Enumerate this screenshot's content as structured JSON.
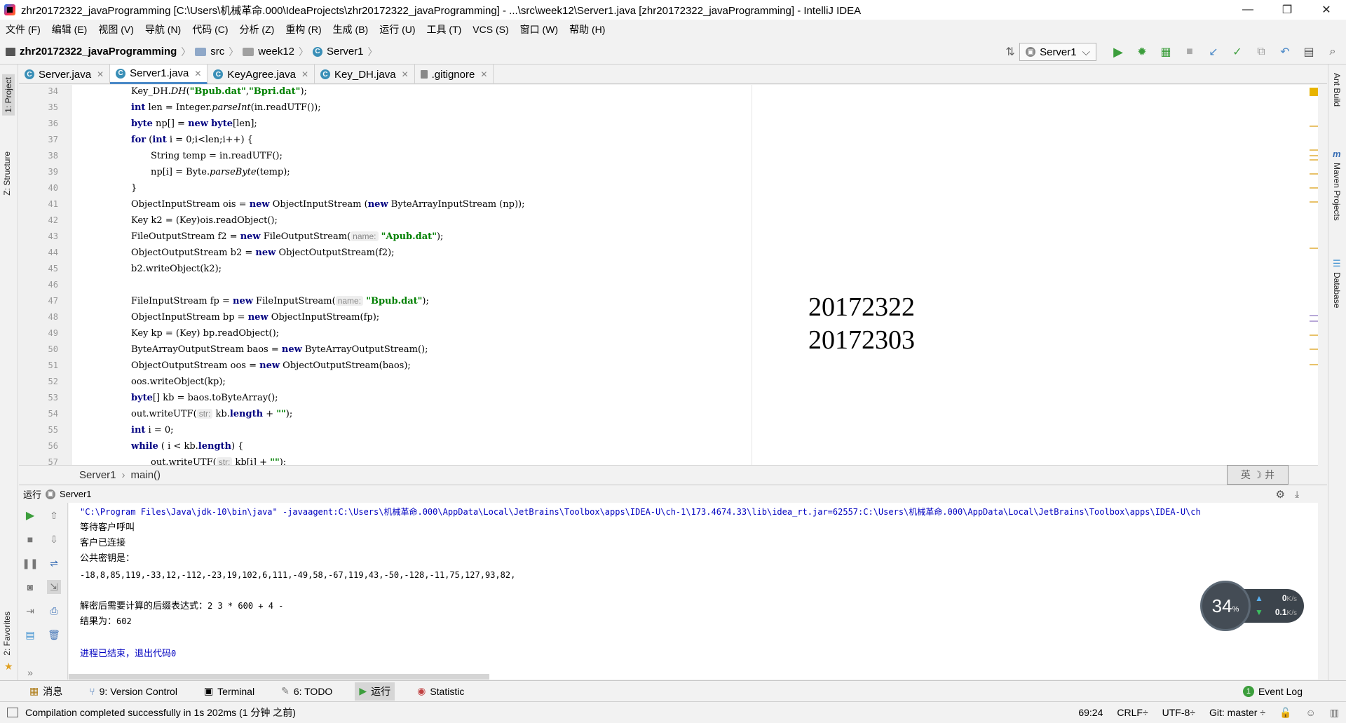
{
  "window": {
    "title": "zhr20172322_javaProgramming [C:\\Users\\机械革命.000\\IdeaProjects\\zhr20172322_javaProgramming] - ...\\src\\week12\\Server1.java [zhr20172322_javaProgramming] - IntelliJ IDEA",
    "minimize": "—",
    "restore": "❐",
    "close": "✕"
  },
  "menu": [
    "文件 (F)",
    "编辑 (E)",
    "视图 (V)",
    "导航 (N)",
    "代码 (C)",
    "分析 (Z)",
    "重构 (R)",
    "生成 (B)",
    "运行 (U)",
    "工具 (T)",
    "VCS (S)",
    "窗口 (W)",
    "帮助 (H)"
  ],
  "nav": {
    "project": "zhr20172322_javaProgramming",
    "src": "src",
    "pkg": "week12",
    "cls": "Server1",
    "run_config": "Server1"
  },
  "left_tools": {
    "project": "1: Project",
    "structure": "Z: Structure",
    "favorites": "2: Favorites"
  },
  "right_tools": {
    "ant": "Ant Build",
    "maven": "Maven Projects",
    "database": "Database"
  },
  "tabs": [
    {
      "label": "Server.java",
      "active": false
    },
    {
      "label": "Server1.java",
      "active": true
    },
    {
      "label": "KeyAgree.java",
      "active": false
    },
    {
      "label": "Key_DH.java",
      "active": false
    },
    {
      "label": ".gitignore",
      "active": false
    }
  ],
  "line_numbers": [
    "34",
    "35",
    "36",
    "37",
    "38",
    "39",
    "40",
    "41",
    "42",
    "43",
    "44",
    "45",
    "46",
    "47",
    "48",
    "49",
    "50",
    "51",
    "52",
    "53",
    "54",
    "55",
    "56",
    "57"
  ],
  "overlay": {
    "line1": "20172322",
    "line2": "20172303"
  },
  "editor_breadcrumb": {
    "cls": "Server1",
    "method": "main()"
  },
  "ime": "英 ☽ 井",
  "run": {
    "label": "运行",
    "config": "Server1"
  },
  "console": {
    "cmd": "\"C:\\Program Files\\Java\\jdk-10\\bin\\java\" -javaagent:C:\\Users\\机械革命.000\\AppData\\Local\\JetBrains\\Toolbox\\apps\\IDEA-U\\ch-1\\173.4674.33\\lib\\idea_rt.jar=62557:C:\\Users\\机械革命.000\\AppData\\Local\\JetBrains\\Toolbox\\apps\\IDEA-U\\ch",
    "l1": "等待客户呼叫",
    "l2": "客户已连接",
    "l3": "公共密钥是：",
    "l4": "-18,8,85,119,-33,12,-112,-23,19,102,6,111,-49,58,-67,119,43,-50,-128,-11,75,127,93,82,",
    "l5a": "解密后需要计算的后缀表达式：",
    "l5b": "2 3 * 600 + 4 -",
    "l6a": "结果为：",
    "l6b": "602",
    "l7a": "进程已结束，退出代码",
    "l7b": "0"
  },
  "net": {
    "percent": "34",
    "pct_sign": "%",
    "up": "0",
    "up_unit": "K/s",
    "down": "0.1",
    "down_unit": "K/s"
  },
  "bottom_tabs": [
    "消息",
    "9: Version Control",
    "Terminal",
    "6: TODO",
    "运行",
    "Statistic"
  ],
  "event_log": {
    "count": "1",
    "label": "Event Log"
  },
  "status": {
    "message": "Compilation completed successfully in 1s 202ms (1 分钟 之前)",
    "position": "69:24",
    "line_sep": "CRLF÷",
    "encoding": "UTF-8÷",
    "git": "Git: master ÷"
  },
  "colors": {
    "keyword": "#000080",
    "string": "#008000",
    "run_green": "#3c9e3c",
    "link_blue": "#0000c0"
  }
}
